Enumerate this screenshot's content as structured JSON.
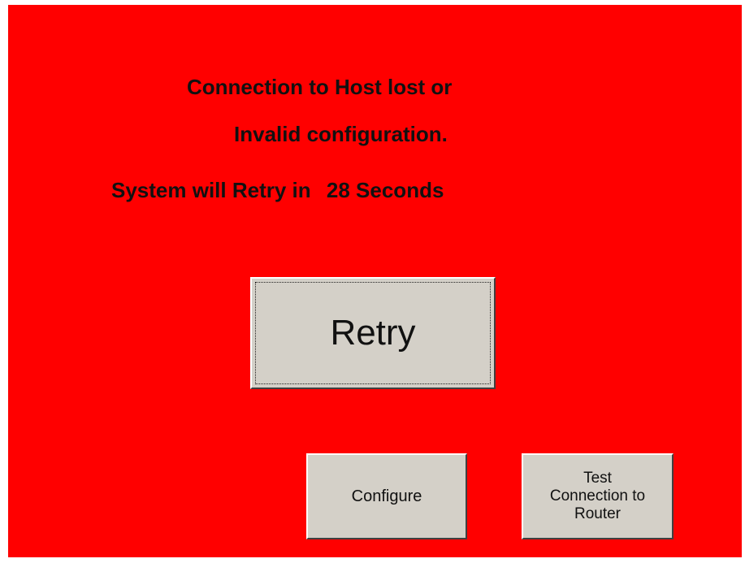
{
  "screen": {
    "background_color": "#ff0000",
    "message": {
      "line1": "Connection to Host lost or",
      "line2": "Invalid configuration.",
      "retry_prefix": "System will Retry in",
      "retry_seconds": "28",
      "retry_suffix": "Seconds"
    }
  },
  "buttons": {
    "retry_label": "Retry",
    "configure_label": "Configure",
    "test_connection_lines": [
      "Test",
      "Connection to",
      "Router"
    ]
  }
}
